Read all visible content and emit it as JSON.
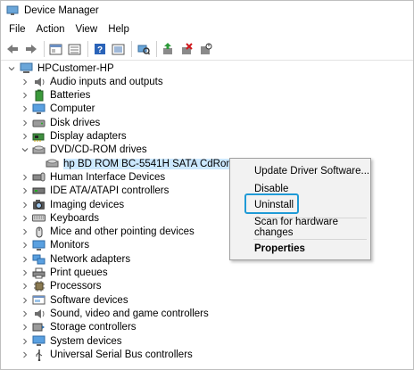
{
  "window": {
    "title": "Device Manager"
  },
  "menu": [
    "File",
    "Action",
    "View",
    "Help"
  ],
  "toolbar_icons": [
    "back-icon",
    "forward-icon",
    "properties-window-icon",
    "device-list-icon",
    "help-icon",
    "show-hide-icon",
    "scan-icon",
    "update-driver-icon",
    "uninstall-device-icon",
    "disable-device-icon"
  ],
  "tree": {
    "root": "HPCustomer-HP",
    "categories": [
      {
        "label": "Audio inputs and outputs",
        "icon": "speaker-icon"
      },
      {
        "label": "Batteries",
        "icon": "battery-icon"
      },
      {
        "label": "Computer",
        "icon": "monitor-icon"
      },
      {
        "label": "Disk drives",
        "icon": "disk-drive-icon"
      },
      {
        "label": "Display adapters",
        "icon": "display-adapter-icon"
      },
      {
        "label": "DVD/CD-ROM drives",
        "icon": "dvd-drive-icon",
        "expanded": true
      },
      {
        "label": "hp BD ROM BC-5541H SATA CdRom Dev",
        "icon": "dvd-drive-icon",
        "child": true,
        "selected": true
      },
      {
        "label": "Human Interface Devices",
        "icon": "hid-icon"
      },
      {
        "label": "IDE ATA/ATAPI controllers",
        "icon": "ide-controller-icon"
      },
      {
        "label": "Imaging devices",
        "icon": "camera-icon"
      },
      {
        "label": "Keyboards",
        "icon": "keyboard-icon"
      },
      {
        "label": "Mice and other pointing devices",
        "icon": "mouse-icon"
      },
      {
        "label": "Monitors",
        "icon": "monitor-icon"
      },
      {
        "label": "Network adapters",
        "icon": "network-adapter-icon"
      },
      {
        "label": "Print queues",
        "icon": "printer-icon"
      },
      {
        "label": "Processors",
        "icon": "processor-icon"
      },
      {
        "label": "Software devices",
        "icon": "software-device-icon"
      },
      {
        "label": "Sound, video and game controllers",
        "icon": "speaker-icon"
      },
      {
        "label": "Storage controllers",
        "icon": "storage-controller-icon"
      },
      {
        "label": "System devices",
        "icon": "system-devices-icon"
      },
      {
        "label": "Universal Serial Bus controllers",
        "icon": "usb-icon"
      }
    ]
  },
  "context_menu": {
    "items": [
      "Update Driver Software...",
      "Disable",
      "Uninstall",
      "Scan for hardware changes",
      "Properties"
    ],
    "highlighted": "Uninstall"
  },
  "colors": {
    "selection": "#cce8ff",
    "highlight_outline": "#1f9ad6",
    "menu_bg": "#f2f2f2"
  }
}
